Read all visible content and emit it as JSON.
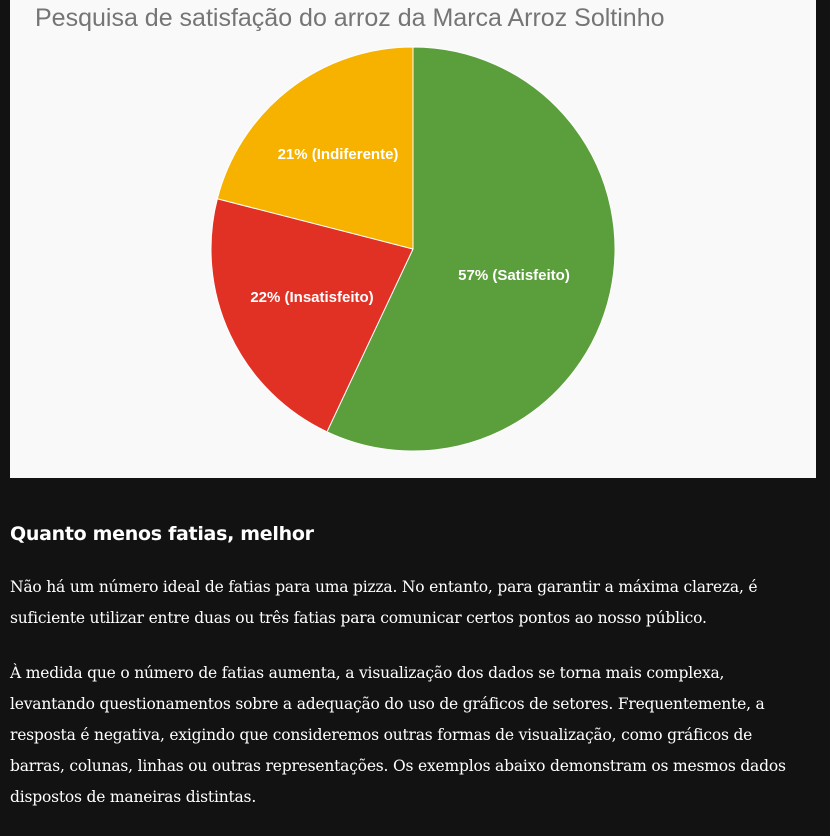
{
  "chart_data": {
    "type": "pie",
    "title": "Pesquisa de satisfação do arroz da Marca Arroz Soltinho",
    "slices": [
      {
        "name": "Satisfeito",
        "value": 57,
        "label": "57% (Satisfeito)",
        "color": "#5b9e3c"
      },
      {
        "name": "Insatisfeito",
        "value": 22,
        "label": "22% (Insatisfeito)",
        "color": "#e13125"
      },
      {
        "name": "Indiferente",
        "value": 21,
        "label": "21% (Indiferente)",
        "color": "#f7b200"
      }
    ],
    "background": "#f9f9f9"
  },
  "article": {
    "heading": "Quanto menos fatias, melhor",
    "paragraphs": [
      "Não há um número ideal de fatias para uma pizza. No entanto, para garantir a máxima clareza, é suficiente utilizar entre duas ou três fatias para comunicar certos pontos ao nosso público.",
      "À medida que o número de fatias aumenta, a visualização dos dados se torna mais complexa, levantando questionamentos sobre a adequação do uso de gráficos de setores. Frequentemente, a resposta é negativa, exigindo que consideremos outras formas de visualização, como gráficos de barras, colunas, linhas ou outras representações. Os exemplos abaixo demonstram os mesmos dados dispostos de maneiras distintas."
    ]
  },
  "colors": {
    "page_background": "#121212",
    "text": "#ffffff"
  }
}
